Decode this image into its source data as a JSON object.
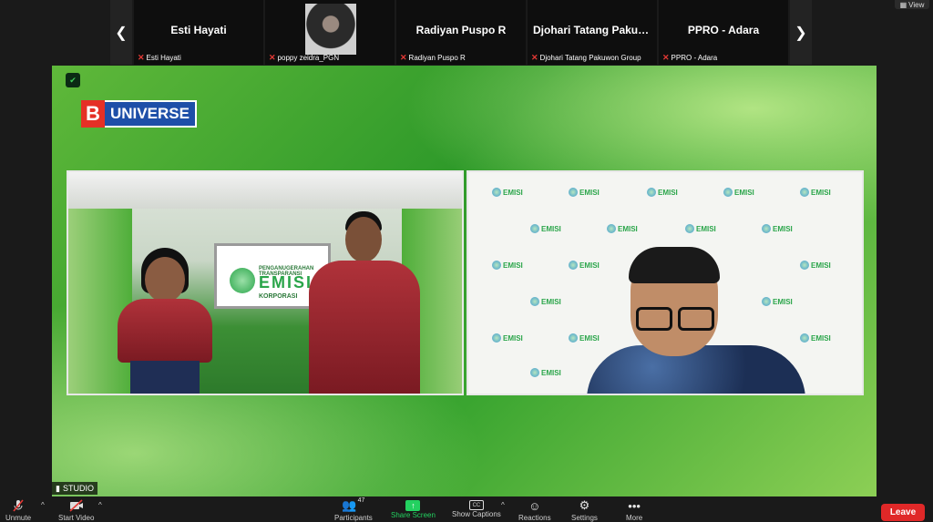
{
  "view_button": {
    "label": "View"
  },
  "participants_strip": [
    {
      "title": "Esti Hayati",
      "label": "Esti Hayati",
      "has_photo": false
    },
    {
      "title": "",
      "label": "poppy zeidra_PGN",
      "has_photo": true
    },
    {
      "title": "Radiyan Puspo R",
      "label": "Radiyan Puspo R",
      "has_photo": false
    },
    {
      "title": "Djohari Tatang Pakuw...",
      "label": "Djohari Tatang Pakuwon Group",
      "has_photo": false
    },
    {
      "title": "PPRO - Adara",
      "label": "PPRO - Adara",
      "has_photo": false
    }
  ],
  "main_video": {
    "logo_b": "B",
    "logo_text": "UNIVERSE",
    "studio_screen": {
      "line1": "PENGANUGERAHAN TRANSPARANSI",
      "big": "EMISI",
      "line2": "KORPORASI"
    },
    "backdrop_logo_text": "EMISI",
    "name_tag": "STUDIO"
  },
  "toolbar": {
    "unmute": "Unmute",
    "start_video": "Start Video",
    "participants": "Participants",
    "participants_count": "47",
    "share_screen": "Share Screen",
    "show_captions": "Show Captions",
    "reactions": "Reactions",
    "settings": "Settings",
    "more": "More",
    "leave": "Leave"
  },
  "colors": {
    "share_green": "#23d160",
    "leave_red": "#e02828",
    "muted_red": "#e53935",
    "stage_green": "#3aa530"
  }
}
